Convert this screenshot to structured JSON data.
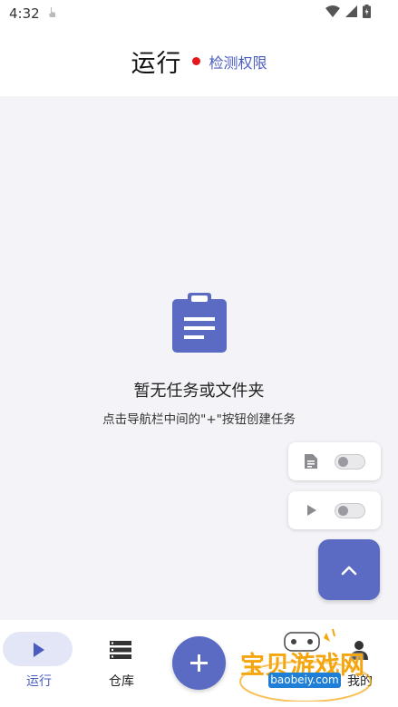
{
  "status_bar": {
    "time": "4:32"
  },
  "header": {
    "title": "运行",
    "check_link": "检测权限"
  },
  "empty_state": {
    "title": "暂无任务或文件夹",
    "subtitle": "点击导航栏中间的\"+\"按钮创建任务"
  },
  "floating_toggles": [
    {
      "icon": "document-icon",
      "state": "off"
    },
    {
      "icon": "play-icon",
      "state": "off"
    }
  ],
  "bottom_nav": {
    "items": [
      {
        "label": "运行",
        "icon": "play-icon",
        "selected": true
      },
      {
        "label": "仓库",
        "icon": "storage-icon",
        "selected": false
      },
      {
        "label": "我的",
        "icon": "person-icon",
        "selected": false
      }
    ]
  },
  "watermark": {
    "text": "宝贝游戏网",
    "url": "baobeiy.com"
  },
  "colors": {
    "accent": "#5b6bc3",
    "dot": "#e8161b",
    "link": "#4a5cc0"
  }
}
